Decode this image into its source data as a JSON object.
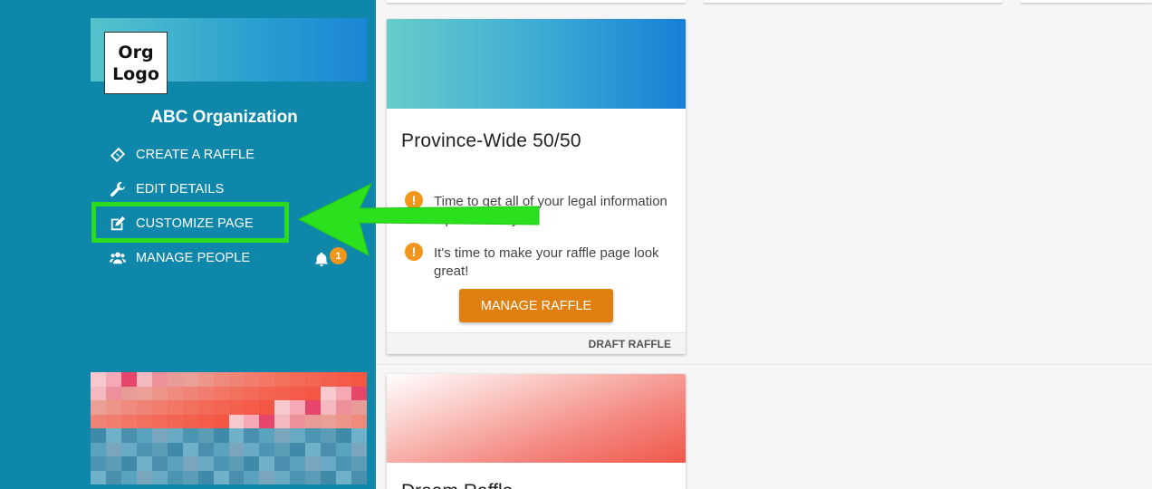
{
  "sidebar": {
    "logo_text": "Org\nLogo",
    "org_name": "ABC Organization",
    "nav": {
      "create_raffle": "CREATE A RAFFLE",
      "edit_details": "EDIT DETAILS",
      "customize_page": "CUSTOMIZE PAGE",
      "manage_people": "MANAGE PEOPLE"
    },
    "notification_count": "1"
  },
  "raffles": [
    {
      "title": "Province-Wide 50/50",
      "notices": [
        "Time to get all of your legal information squared away.",
        "It's time to make your raffle page look great!"
      ],
      "action_label": "MANAGE RAFFLE",
      "status": "DRAFT RAFFLE"
    },
    {
      "title": "Dream Raffle"
    }
  ],
  "colors": {
    "sidebar_bg": "#0f87ab",
    "highlight": "#2bdc1e",
    "action_button": "#e07f0d",
    "warning": "#f0961a"
  },
  "icons": [
    "ticket-icon",
    "wrench-icon",
    "edit-icon",
    "users-icon",
    "bell-icon",
    "warning-icon"
  ]
}
